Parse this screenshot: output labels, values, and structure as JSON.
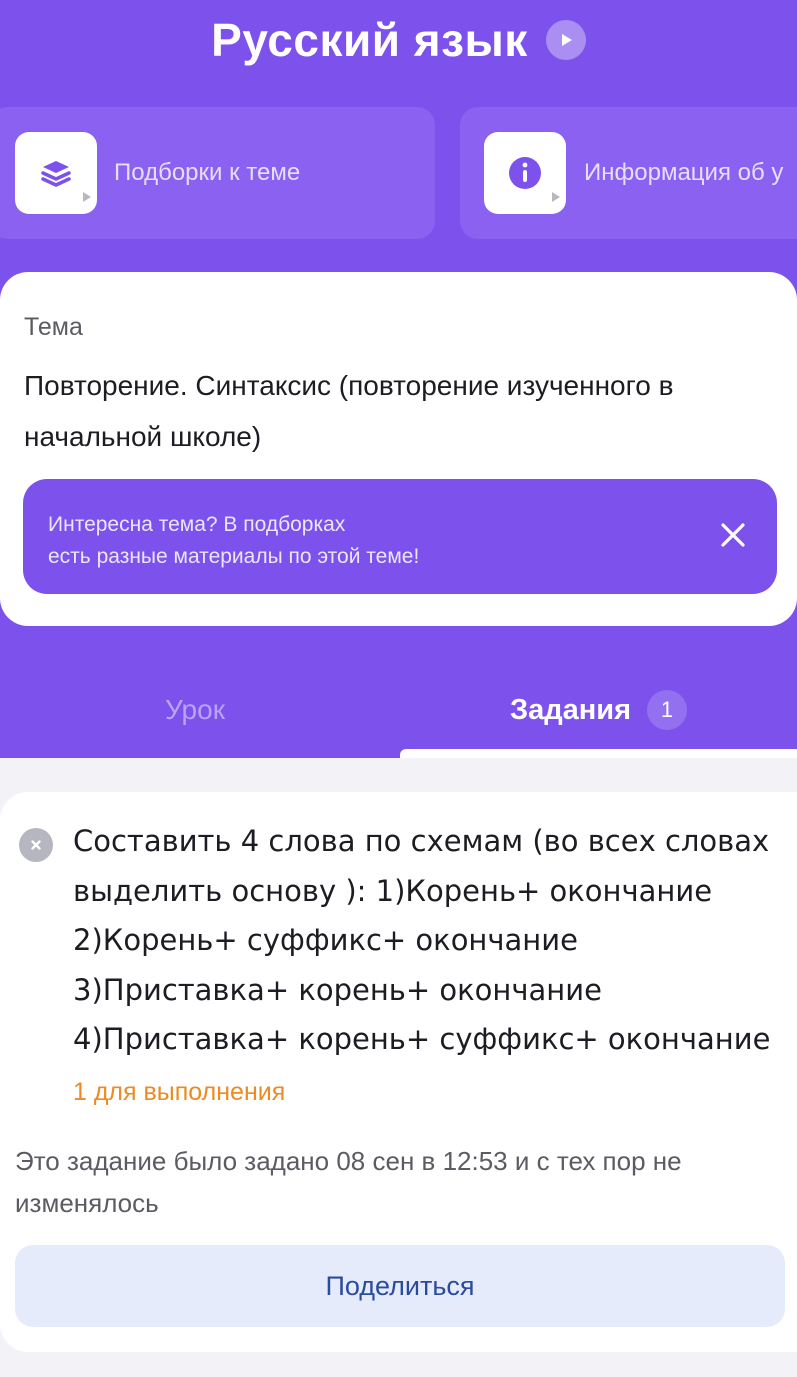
{
  "header": {
    "title": "Русский язык",
    "play_icon": "play-circle-icon"
  },
  "quick_cards": [
    {
      "label": "Подборки к теме",
      "icon": "stack-layers-icon"
    },
    {
      "label": "Информация об у",
      "icon": "info-circle-icon"
    }
  ],
  "theme": {
    "label": "Тема",
    "text": "Повторение. Синтаксис (повторение изученного в начальной школе)"
  },
  "promo": {
    "line1": "Интересна тема? В подборках",
    "line2": "есть разные материалы по этой теме!",
    "close_icon": "close-icon"
  },
  "tabs": {
    "lesson": "Урок",
    "tasks": "Задания",
    "tasks_badge": "1"
  },
  "task": {
    "lines": [
      "Составить 4 слова по схемам (во всех словах",
      "выделить основу ): 1)Корень+ окончание",
      "2)Корень+ суффикс+ окончание",
      "3)Приставка+ корень+ окончание",
      "4)Приставка+ корень+ суффикс+ окончание"
    ],
    "due": "1 для выполнения",
    "meta": "Это задание было задано 08 сен в 12:53 и с тех пор не изменялось",
    "share_label": "Поделиться"
  },
  "colors": {
    "brand_purple": "#7d52ec",
    "due_orange": "#ee8a22",
    "share_text": "#2a4c9c"
  }
}
